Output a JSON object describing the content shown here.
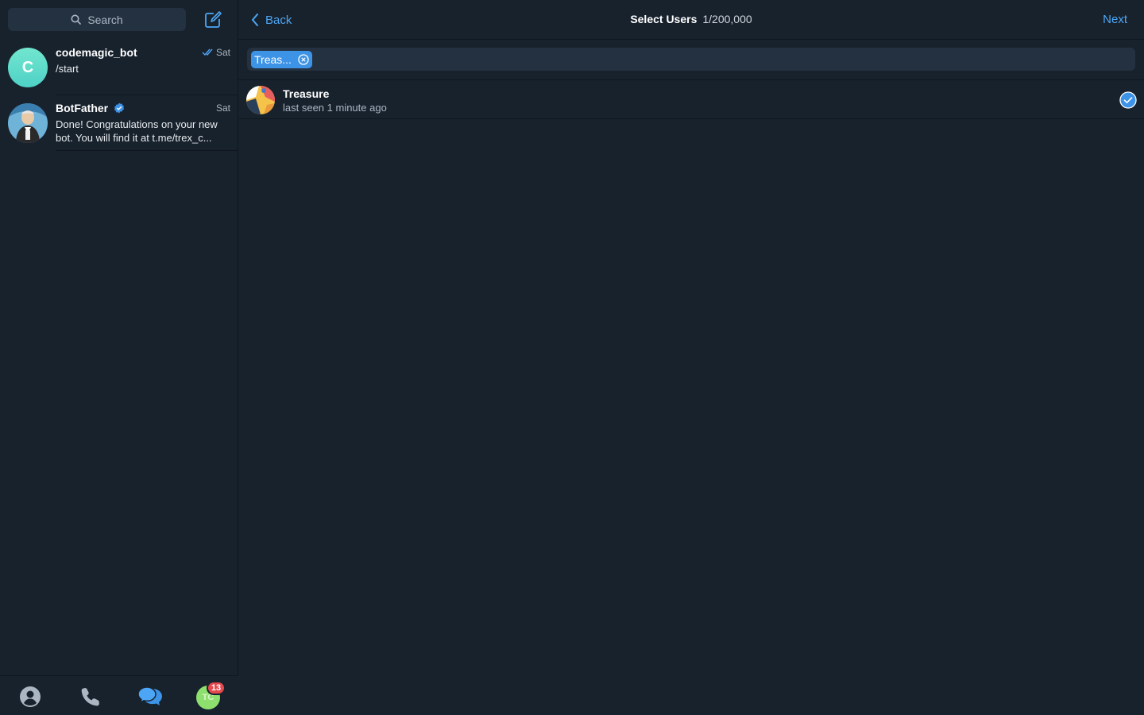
{
  "sidebar": {
    "search_placeholder": "Search",
    "chats": [
      {
        "name": "codemagic_bot",
        "avatar_letter": "C",
        "avatar_color": "#5ddbc9",
        "date": "Sat",
        "preview": "/start",
        "read_status": "double-check"
      },
      {
        "name": "BotFather",
        "verified": true,
        "date": "Sat",
        "preview": "Done! Congratulations on your new bot. You will find it at t.me/trex_c..."
      }
    ],
    "tabs": [
      "contacts",
      "calls",
      "chats",
      "settings"
    ],
    "profile_initials": "TC",
    "unread_badge": "13"
  },
  "header": {
    "back_label": "Back",
    "title": "Select Users",
    "count": "1/200,000",
    "next_label": "Next"
  },
  "selection": {
    "token_label": "Treas..."
  },
  "users": [
    {
      "name": "Treasure",
      "status": "last seen 1 minute ago",
      "selected": true
    }
  ],
  "colors": {
    "accent": "#4da6f5",
    "background": "#18222d",
    "field": "#243140",
    "badge": "#e5484d"
  }
}
